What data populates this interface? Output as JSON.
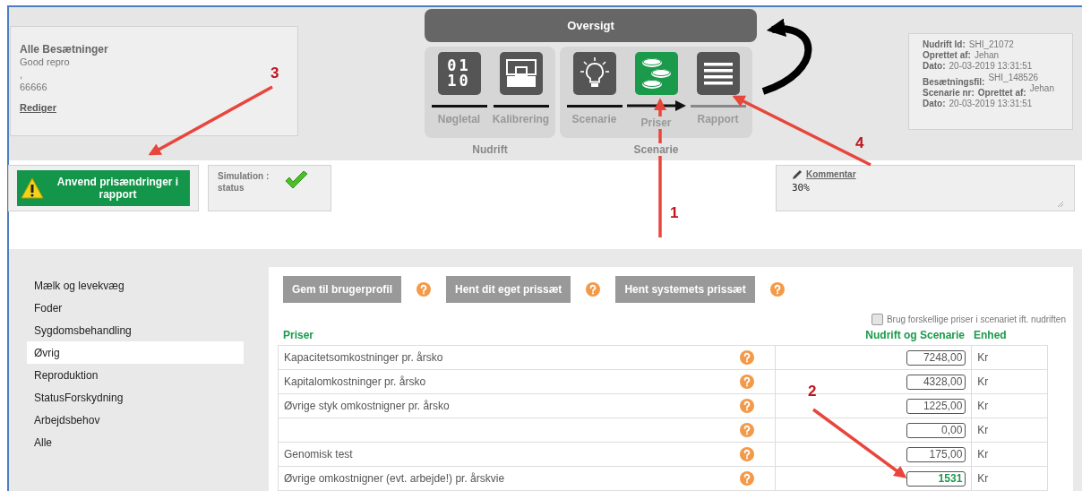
{
  "herd_card": {
    "title": "Alle Besætninger",
    "lines": [
      "Good repro",
      ",",
      "66666"
    ],
    "link": "Rediger"
  },
  "overview": {
    "title": "Oversigt",
    "groups": [
      {
        "label": "Nudrift",
        "steps": [
          {
            "label": "Nøgletal",
            "kind": "binary",
            "glyph_lines": [
              "01",
              "10"
            ],
            "selected": false,
            "completed": true
          },
          {
            "label": "Kalibrering",
            "kind": "screen",
            "selected": false,
            "completed": true
          }
        ]
      },
      {
        "label": "Scenarie",
        "steps": [
          {
            "label": "Scenarie",
            "kind": "bulb",
            "selected": false,
            "completed": true
          },
          {
            "label": "Priser",
            "kind": "coins",
            "selected": true,
            "completed": true
          },
          {
            "label": "Rapport",
            "kind": "lines",
            "selected": false,
            "completed": false
          }
        ]
      }
    ]
  },
  "info_card": {
    "blocks": [
      [
        {
          "labels": [
            "Nudrift Id:"
          ],
          "value": "SHI_21072"
        },
        {
          "labels": [
            "Oprettet af:"
          ],
          "value": "Jehan"
        },
        {
          "labels": [
            "Dato:"
          ],
          "value": "20-03-2019 13:31:51"
        }
      ],
      [
        {
          "labels": [
            "Besætningsfil:"
          ],
          "value": "SHI_148526"
        },
        {
          "labels": [
            "Scenarie nr:",
            "Oprettet af:"
          ],
          "value": "Jehan"
        },
        {
          "labels": [
            "Dato:"
          ],
          "value": "20-03-2019 13:31:51"
        }
      ]
    ]
  },
  "apply_button": {
    "label": "Anvend prisændringer i rapport"
  },
  "simulation_status": {
    "label": "Simulation : status",
    "ok": true
  },
  "comment": {
    "link": "Kommentar",
    "value": "30%"
  },
  "sidebar": {
    "items": [
      {
        "label": "Mælk og levekvæg",
        "selected": false
      },
      {
        "label": "Foder",
        "selected": false
      },
      {
        "label": "Sygdomsbehandling",
        "selected": false
      },
      {
        "label": "Øvrig",
        "selected": true
      },
      {
        "label": "Reproduktion",
        "selected": false
      },
      {
        "label": "StatusForskydning",
        "selected": false
      },
      {
        "label": "Arbejdsbehov",
        "selected": false
      },
      {
        "label": "Alle",
        "selected": false
      }
    ]
  },
  "toolbar": {
    "buttons": [
      "Gem til brugerprofil",
      "Hent dit eget prissæt",
      "Hent systemets prissæt"
    ]
  },
  "different_prices": {
    "label": "Brug forskellige priser i scenariet ift. nudriften",
    "checked": false
  },
  "table": {
    "columns": [
      "Priser",
      "Nudrift og Scenarie",
      "Enhed"
    ],
    "rows": [
      {
        "label": "Kapacitetsomkostninger pr. årsko",
        "value": "7248,00",
        "unit": "Kr",
        "highlighted": false
      },
      {
        "label": "Kapitalomkostninger pr. årsko",
        "value": "4328,00",
        "unit": "Kr",
        "highlighted": false
      },
      {
        "label": "Øvrige styk omkostnigner pr. årsko",
        "value": "1225,00",
        "unit": "Kr",
        "highlighted": false
      },
      {
        "value": "0,00",
        "unit": "Kr",
        "highlighted": false
      },
      {
        "label": "Genomisk test",
        "value": "175,00",
        "unit": "Kr",
        "highlighted": false
      },
      {
        "label": "Øvrige omkostnigner (evt. arbejde!) pr. årskvie",
        "value": "1531",
        "unit": "Kr",
        "highlighted": true
      }
    ]
  },
  "annotations": [
    {
      "label": "1"
    },
    {
      "label": "2"
    },
    {
      "label": "3"
    },
    {
      "label": "4"
    }
  ]
}
